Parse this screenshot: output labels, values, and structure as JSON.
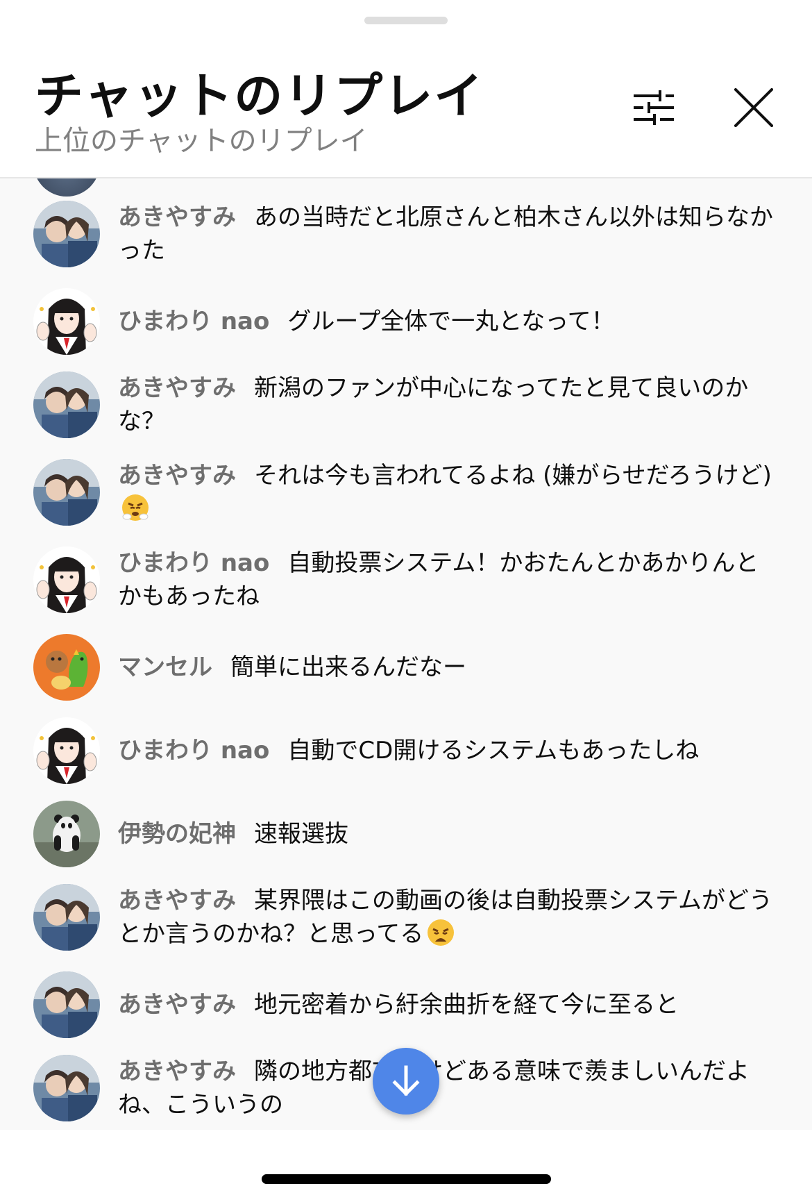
{
  "header": {
    "title": "チャットのリプレイ",
    "subtitle": "上位のチャットのリプレイ"
  },
  "messages": [
    {
      "author": "あきやすみ",
      "text": "あの当時だと北原さんと柏木さん以外は知らなかった",
      "avatar": "avatar-akiyasumi"
    },
    {
      "author": "ひまわり nao",
      "text": "グループ全体で一丸となって！",
      "avatar": "avatar-himawari"
    },
    {
      "author": "あきやすみ",
      "text": "新潟のファンが中心になってたと見て良いのかな？",
      "avatar": "avatar-akiyasumi"
    },
    {
      "author": "あきやすみ",
      "text": "それは今も言われてるよね (嫌がらせだろうけど)",
      "avatar": "avatar-akiyasumi",
      "emoji": "steam-face-emoji"
    },
    {
      "author": "ひまわり nao",
      "text": "自動投票システム！かおたんとかあかりんとかもあったね",
      "avatar": "avatar-himawari"
    },
    {
      "author": "マンセル",
      "text": "簡単に出来るんだなー",
      "avatar": "avatar-mansell"
    },
    {
      "author": "ひまわり nao",
      "text": "自動でCD開けるシステムもあったしね",
      "avatar": "avatar-himawari"
    },
    {
      "author": "伊勢の妃神",
      "text": "速報選抜",
      "avatar": "avatar-panda"
    },
    {
      "author": "あきやすみ",
      "text": "某界隈はこの動画の後は自動投票システムがどうとか言うのかね？と思ってる",
      "avatar": "avatar-akiyasumi",
      "emoji": "weary-face-emoji"
    },
    {
      "author": "あきやすみ",
      "text": "地元密着から紆余曲折を経て今に至ると",
      "avatar": "avatar-akiyasumi"
    },
    {
      "author": "あきやすみ",
      "text": "隣の地方都市だけどある意味で羨ましいんだよね、こういうの",
      "avatar": "avatar-akiyasumi"
    }
  ],
  "icons": {
    "filter": "sliders-icon",
    "close": "close-icon",
    "scroll_down": "arrow-down-icon"
  },
  "colors": {
    "accent_button": "#4f86e8",
    "author_text": "#6e6e6e",
    "chat_background": "#f9f9f9"
  }
}
